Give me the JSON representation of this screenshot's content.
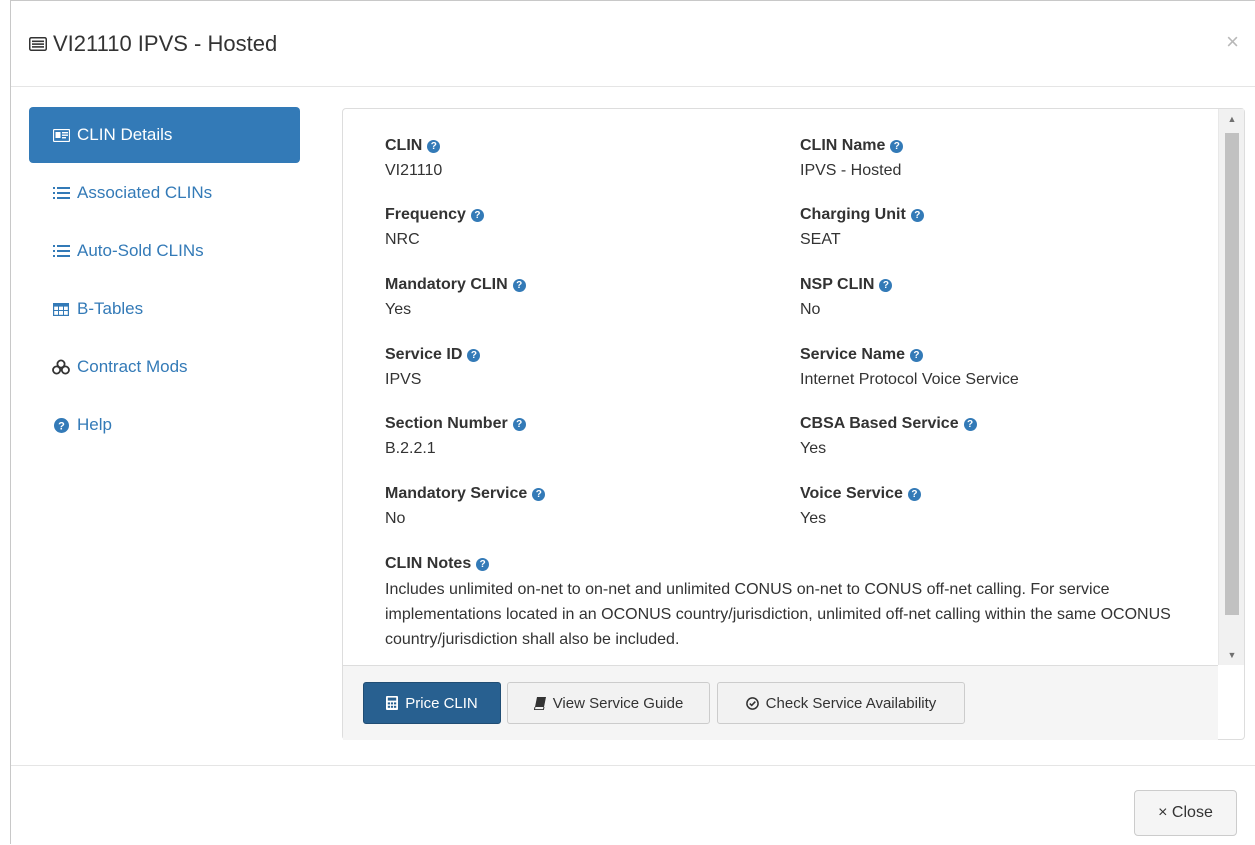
{
  "modal": {
    "title": "VI21110 IPVS - Hosted",
    "close_x": "×",
    "title_icon": "list-alt-icon"
  },
  "sidebar": {
    "items": [
      {
        "label": "CLIN Details",
        "icon": "id-card-icon",
        "active": true
      },
      {
        "label": "Associated CLINs",
        "icon": "list-icon",
        "active": false
      },
      {
        "label": "Auto-Sold CLINs",
        "icon": "list-icon",
        "active": false
      },
      {
        "label": "B-Tables",
        "icon": "table-icon",
        "active": false
      },
      {
        "label": "Contract Mods",
        "icon": "link-icon",
        "active": false
      },
      {
        "label": "Help",
        "icon": "question-circle-icon",
        "active": false
      }
    ]
  },
  "details": {
    "clin": {
      "label": "CLIN",
      "value": "VI21110"
    },
    "clin_name": {
      "label": "CLIN Name",
      "value": "IPVS - Hosted"
    },
    "frequency": {
      "label": "Frequency",
      "value": "NRC"
    },
    "charging_unit": {
      "label": "Charging Unit",
      "value": "SEAT"
    },
    "mandatory_clin": {
      "label": "Mandatory CLIN",
      "value": "Yes"
    },
    "nsp_clin": {
      "label": "NSP CLIN",
      "value": "No"
    },
    "service_id": {
      "label": "Service ID",
      "value": "IPVS"
    },
    "service_name": {
      "label": "Service Name",
      "value": "Internet Protocol Voice Service"
    },
    "section_number": {
      "label": "Section Number",
      "value": "B.2.2.1"
    },
    "cbsa_based_service": {
      "label": "CBSA Based Service",
      "value": "Yes"
    },
    "mandatory_service": {
      "label": "Mandatory Service",
      "value": "No"
    },
    "voice_service": {
      "label": "Voice Service",
      "value": "Yes"
    },
    "clin_notes": {
      "label": "CLIN Notes",
      "value": "Includes unlimited on-net to on-net and unlimited CONUS on-net to CONUS off-net calling. For service implementations located in an OCONUS country/jurisdiction, unlimited off-net calling within the same OCONUS country/jurisdiction shall also be included."
    }
  },
  "actions": {
    "price_clin": "Price CLIN",
    "view_service_guide": "View Service Guide",
    "check_service_availability": "Check Service Availability"
  },
  "footer": {
    "close_label": "× Close"
  },
  "colors": {
    "primary": "#337ab7",
    "primary_dark": "#286090",
    "text": "#333333"
  }
}
